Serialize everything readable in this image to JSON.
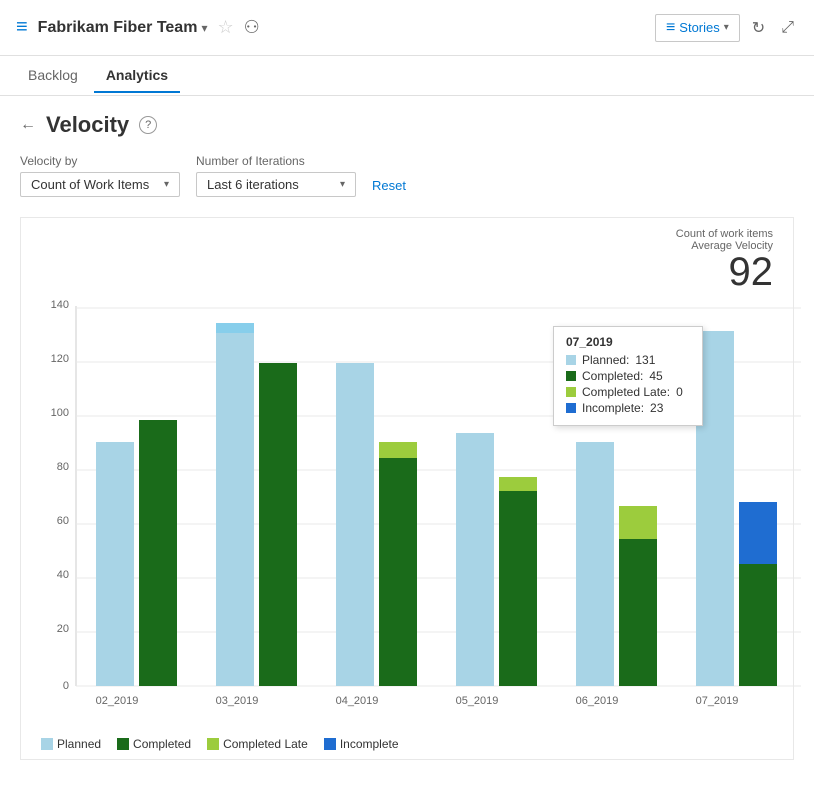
{
  "header": {
    "icon": "≡",
    "title": "Fabrikam Fiber Team",
    "chevron": "▾",
    "star": "☆",
    "people_icon": "👥",
    "stories_label": "Stories",
    "stories_chevron": "▾",
    "refresh_icon": "↻",
    "expand_icon": "⤢"
  },
  "nav": {
    "tabs": [
      {
        "label": "Backlog",
        "active": false
      },
      {
        "label": "Analytics",
        "active": true
      }
    ]
  },
  "velocity": {
    "back_icon": "←",
    "title": "Velocity",
    "help_icon": "?",
    "filters": {
      "velocity_by_label": "Velocity by",
      "velocity_by_value": "Count of Work Items",
      "iterations_label": "Number of Iterations",
      "iterations_value": "Last 6 iterations",
      "reset_label": "Reset"
    },
    "chart": {
      "metric_label": "Count of work items",
      "avg_label": "Average Velocity",
      "avg_value": "92",
      "y_axis": [
        0,
        20,
        40,
        60,
        80,
        100,
        120,
        140
      ],
      "bars": [
        {
          "sprint": "02_2019",
          "planned": 90,
          "completed": 98,
          "completed_late": 0,
          "incomplete": 0
        },
        {
          "sprint": "03_2019",
          "planned": 130,
          "completed": 119,
          "completed_late": 0,
          "incomplete": 0
        },
        {
          "sprint": "04_2019",
          "planned": 119,
          "completed": 84,
          "completed_late": 6,
          "incomplete": 0
        },
        {
          "sprint": "05_2019",
          "planned": 93,
          "completed": 72,
          "completed_late": 5,
          "incomplete": 0
        },
        {
          "sprint": "06_2019",
          "planned": 90,
          "completed": 54,
          "completed_late": 12,
          "incomplete": 0
        },
        {
          "sprint": "07_2019",
          "planned": 131,
          "completed": 45,
          "completed_late": 0,
          "incomplete": 23
        }
      ],
      "tooltip": {
        "title": "07_2019",
        "planned_label": "Planned:",
        "planned_value": "131",
        "completed_label": "Completed:",
        "completed_value": "45",
        "completed_late_label": "Completed Late:",
        "completed_late_value": "0",
        "incomplete_label": "Incomplete:",
        "incomplete_value": "23"
      },
      "legend": [
        {
          "label": "Planned",
          "color": "#a8d4e6"
        },
        {
          "label": "Completed",
          "color": "#1a6b1a"
        },
        {
          "label": "Completed Late",
          "color": "#9ccc3d"
        },
        {
          "label": "Incomplete",
          "color": "#1f6dd1"
        }
      ]
    }
  }
}
